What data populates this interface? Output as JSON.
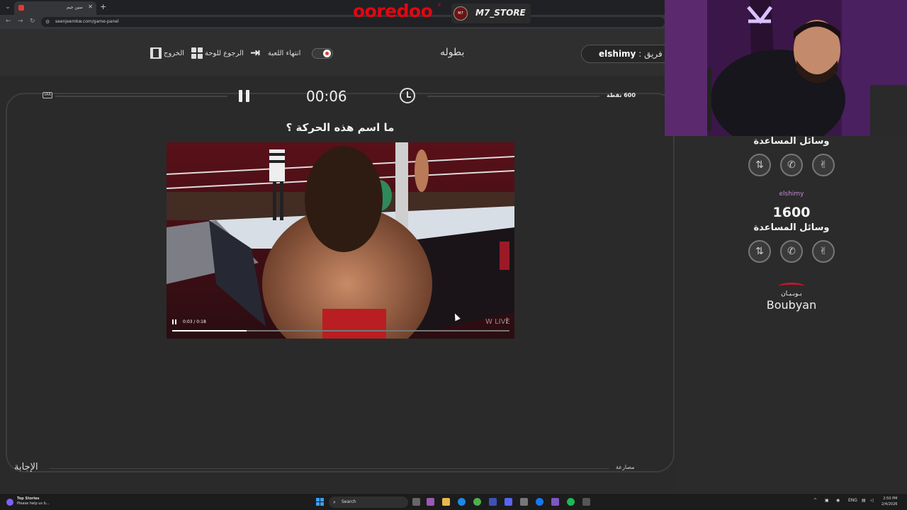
{
  "browser": {
    "tab_title": "سين جيم",
    "url": "seenjeemkw.com/game-panel"
  },
  "sponsors": {
    "ooredoo": "ooredoo",
    "m7_store": "M7_STORE",
    "boubyan_ar": "بـوبـيـان",
    "boubyan_en": "Boubyan"
  },
  "toolbar": {
    "exit_label": "الخروج",
    "back_to_board_label": "الرجوع للوحة",
    "end_game_label": "انتهاء اللعبة",
    "tournament_label": "بطوله",
    "team_prefix": "دور فريق :",
    "team_name": "elshimy"
  },
  "question_panel": {
    "var_label": "VAR",
    "timer": "00:06",
    "points": "600 نقطة",
    "question_text": "ما اسم هذه الحركة ؟",
    "answer_label": "الإجابة",
    "category_label": "مصارعة"
  },
  "video": {
    "time_display": "0:03 / 0:18",
    "progress_fraction": 0.22
  },
  "right_panel": {
    "aids_title_1": "وسائل المساعدة",
    "team2_name": "elshimy",
    "team2_score": "1600",
    "aids_title_2": "وسائل المساعدة"
  },
  "taskbar": {
    "news_title": "Top Stories",
    "news_sub": "Please help us b...",
    "search_placeholder": "Search",
    "lang": "ENG",
    "time": "2:50 PM",
    "date": "2/4/2026"
  }
}
